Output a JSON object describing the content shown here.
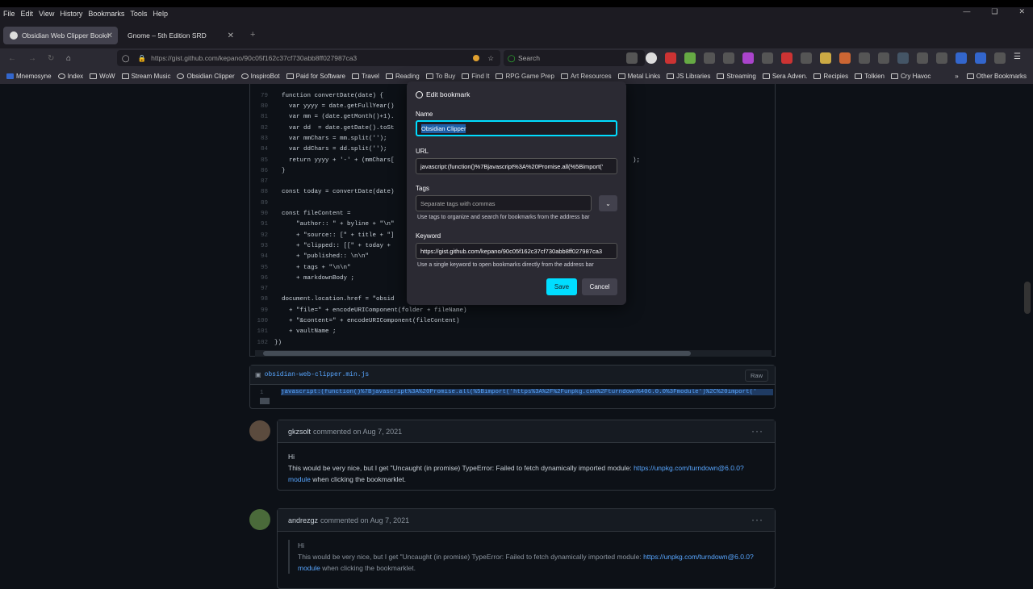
{
  "menu": [
    "File",
    "Edit",
    "View",
    "History",
    "Bookmarks",
    "Tools",
    "Help"
  ],
  "tabs": [
    {
      "label": "Obsidian Web Clipper Bookma"
    },
    {
      "label": "Gnome – 5th Edition SRD"
    }
  ],
  "url": "https://gist.github.com/kepano/90c05f162c37cf730abb8ff027987ca3",
  "search_placeholder": "Search",
  "bookmarks": [
    "Mnemosyne",
    "Index",
    "WoW",
    "Stream Music",
    "Obsidian Clipper",
    "InspiroBot",
    "Paid for Software",
    "Travel",
    "Reading",
    "To Buy",
    "Find It",
    "RPG Game Prep",
    "Art Resources",
    "Metal Links",
    "JS Libraries",
    "Streaming",
    "Sera Adven.",
    "Recipies",
    "Tolkien",
    "Cry Havoc"
  ],
  "other_bookmarks": "Other Bookmarks",
  "code": [
    {
      "n": "79",
      "t": "  function convertDate(date) {"
    },
    {
      "n": "80",
      "t": "    var yyyy = date.getFullYear()"
    },
    {
      "n": "81",
      "t": "    var mm = (date.getMonth()+1)."
    },
    {
      "n": "82",
      "t": "    var dd  = date.getDate().toSt"
    },
    {
      "n": "83",
      "t": "    var mmChars = mm.split('');"
    },
    {
      "n": "84",
      "t": "    var ddChars = dd.split('');"
    },
    {
      "n": "85",
      "t": "    return yyyy + '-' + (mmChars["
    },
    {
      "n": "86",
      "t": "  }"
    },
    {
      "n": "87",
      "t": ""
    },
    {
      "n": "88",
      "t": "  const today = convertDate(date)"
    },
    {
      "n": "89",
      "t": ""
    },
    {
      "n": "90",
      "t": "  const fileContent ="
    },
    {
      "n": "91",
      "t": "      \"author:: \" + byline + \"\\n\""
    },
    {
      "n": "92",
      "t": "      + \"source:: [\" + title + \"]"
    },
    {
      "n": "93",
      "t": "      + \"clipped:: [[\" + today +"
    },
    {
      "n": "94",
      "t": "      + \"published:: \\n\\n\""
    },
    {
      "n": "95",
      "t": "      + tags + \"\\n\\n\""
    },
    {
      "n": "96",
      "t": "      + markdownBody ;"
    },
    {
      "n": "97",
      "t": ""
    },
    {
      "n": "98",
      "t": "  document.location.href = \"obsid"
    },
    {
      "n": "99",
      "t": "    + \"file=\" + encodeURIComponent(folder + fileName)"
    },
    {
      "n": "100",
      "t": "    + \"&content=\" + encodeURIComponent(fileContent)"
    },
    {
      "n": "101",
      "t": "    + vaultName ;"
    },
    {
      "n": "102",
      "t": "})"
    }
  ],
  "code_tail": ");",
  "file": {
    "name": "obsidian-web-clipper.min.js",
    "raw": "Raw",
    "line": "javascript:(function()%7Bjavascript%3A%20Promise.all(%5Bimport('https%3A%2F%2Funpkg.com%2Fturndown%406.0.0%3Fmodule')%2C%20import('"
  },
  "comments": [
    {
      "user": "gkzsolt",
      "meta": "commented on Aug 7, 2021",
      "greeting": "Hi",
      "body": "This would be very nice, but I get \"Uncaught (in promise) TypeError: Failed to fetch dynamically imported module: ",
      "link": "https://unpkg.com/turndown@6.0.0?module",
      "tail": " when clicking the bookmarklet."
    },
    {
      "user": "andrezgz",
      "meta": "commented on Aug 7, 2021",
      "greeting": "Hi",
      "body": "This would be very nice, but I get \"Uncaught (in promise) TypeError: Failed to fetch dynamically imported module: ",
      "link": "https://unpkg.com/turndown@6.0.0?module",
      "tail": " when clicking the bookmarklet."
    }
  ],
  "dialog": {
    "title": "Edit bookmark",
    "name_label": "Name",
    "name_value": "Obsidian Clipper",
    "url_label": "URL",
    "url_value": "javascript:(function()%7Bjavascript%3A%20Promise.all(%5Bimport('",
    "tags_label": "Tags",
    "tags_placeholder": "Separate tags with commas",
    "tags_hint": "Use tags to organize and search for bookmarks from the address bar",
    "keyword_label": "Keyword",
    "keyword_value": "https://gist.github.com/kepano/90c05f162c37cf730abb8ff027987ca3",
    "keyword_hint": "Use a single keyword to open bookmarks directly from the address bar",
    "save": "Save",
    "cancel": "Cancel"
  },
  "colors": {
    "accent": "#00ddff",
    "link": "#58a6ff"
  }
}
